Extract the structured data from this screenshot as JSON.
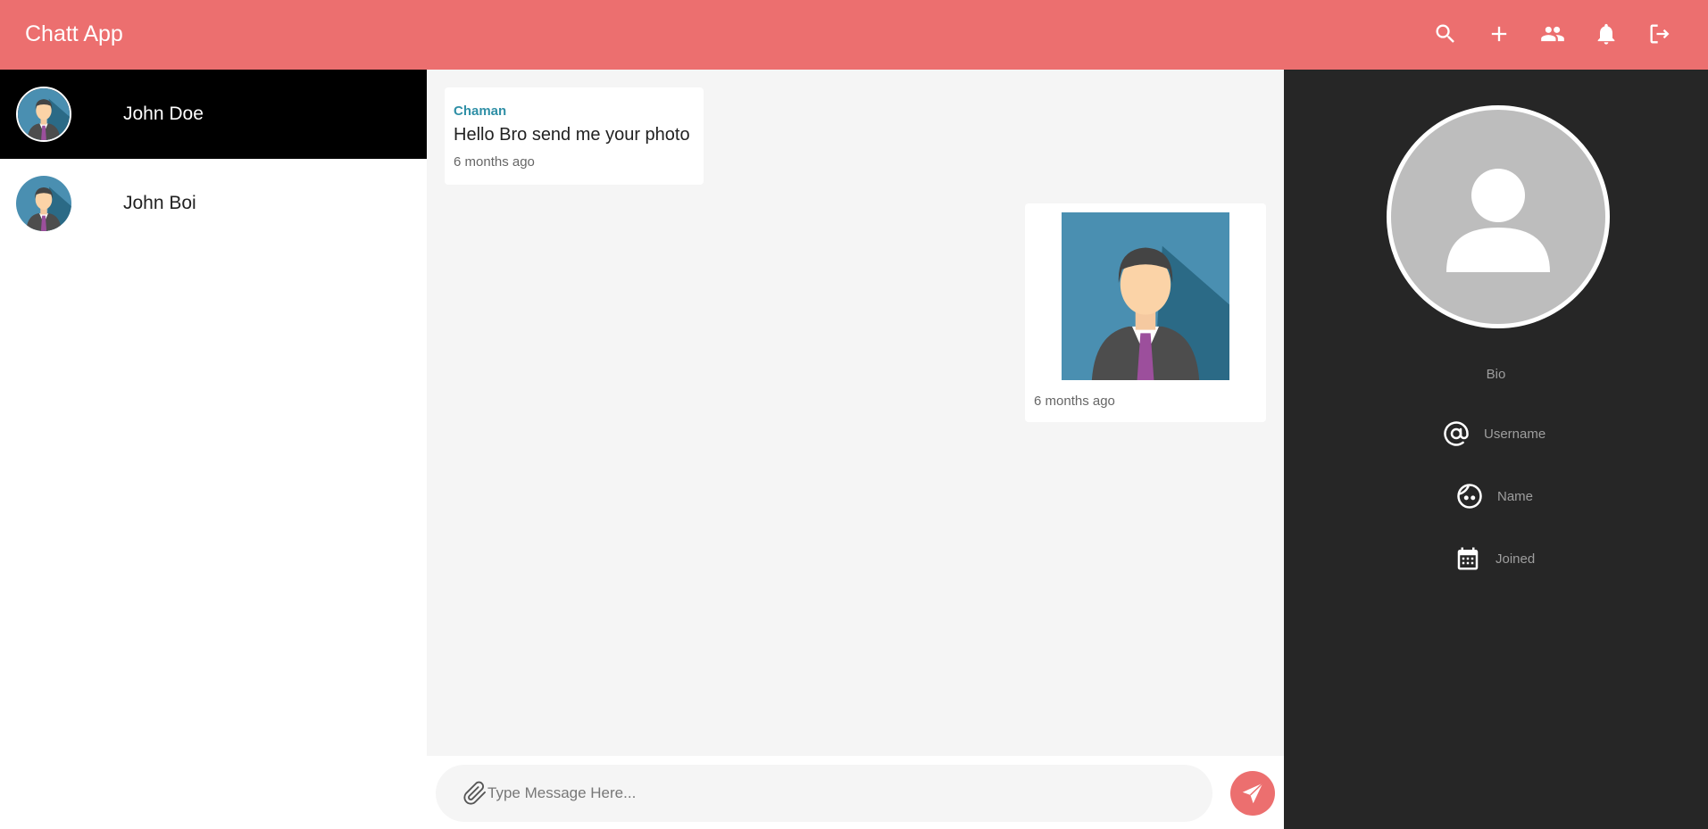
{
  "app": {
    "title": "Chatt App",
    "colors": {
      "primary": "#ec6f6f",
      "dark_panel": "#262626",
      "accent_sender": "#2f8fa6",
      "active_contact": "#000000"
    }
  },
  "toolbar": {
    "icons": [
      "search-icon",
      "add-icon",
      "group-icon",
      "notifications-icon",
      "logout-icon"
    ]
  },
  "contacts": [
    {
      "name": "John Doe",
      "active": true
    },
    {
      "name": "John Boi",
      "active": false
    }
  ],
  "messages": {
    "incoming": {
      "sender": "Chaman",
      "text": "Hello Bro send me your photo",
      "time": "6 months ago"
    },
    "outgoing": {
      "type": "image",
      "time": "6 months ago"
    }
  },
  "composer": {
    "placeholder": "Type Message Here..."
  },
  "profile": {
    "bio": "Bio",
    "username_label": "Username",
    "name_label": "Name",
    "joined_label": "Joined"
  }
}
